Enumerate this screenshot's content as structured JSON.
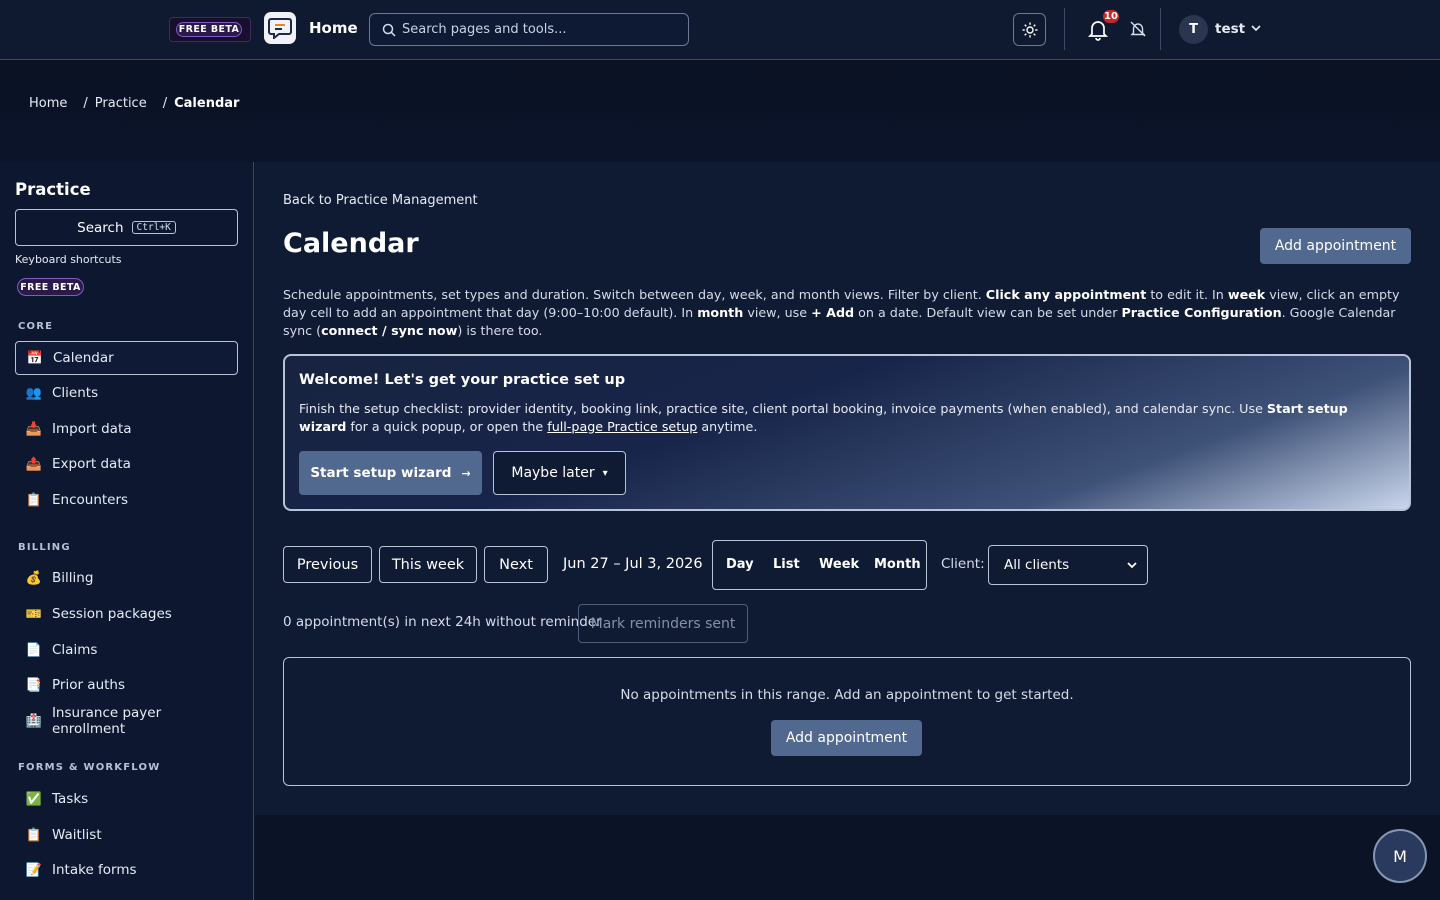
{
  "topbar": {
    "beta_badge": "FREE BETA",
    "home_title": "Home",
    "search_placeholder": "Search pages and tools...",
    "notification_count": "10",
    "user_initial": "T",
    "username": "test"
  },
  "breadcrumb": {
    "items": [
      "Home",
      "Practice",
      "Calendar"
    ],
    "separator": "/"
  },
  "sidebar": {
    "title": "Practice",
    "search_label": "Search",
    "search_shortcut": "Ctrl+K",
    "keyboard_shortcuts": "Keyboard shortcuts",
    "beta_badge": "FREE BETA",
    "sections": [
      {
        "label": "CORE",
        "items": [
          {
            "icon": "📅",
            "label": "Calendar"
          },
          {
            "icon": "👥",
            "label": "Clients"
          },
          {
            "icon": "📥",
            "label": "Import data"
          },
          {
            "icon": "📤",
            "label": "Export data"
          },
          {
            "icon": "📋",
            "label": "Encounters"
          }
        ]
      },
      {
        "label": "BILLING",
        "items": [
          {
            "icon": "💰",
            "label": "Billing"
          },
          {
            "icon": "🎫",
            "label": "Session packages"
          },
          {
            "icon": "📄",
            "label": "Claims"
          },
          {
            "icon": "📑",
            "label": "Prior auths"
          },
          {
            "icon": "🏥",
            "label": "Insurance payer enrollment"
          }
        ]
      },
      {
        "label": "FORMS & WORKFLOW",
        "items": [
          {
            "icon": "✅",
            "label": "Tasks"
          },
          {
            "icon": "📋",
            "label": "Waitlist"
          },
          {
            "icon": "📝",
            "label": "Intake forms"
          }
        ]
      }
    ]
  },
  "main": {
    "back_link": "Back to Practice Management",
    "title": "Calendar",
    "add_appointment": "Add appointment",
    "description": {
      "p1": "Schedule appointments, set types and duration. Switch between day, week, and month views. Filter by client. ",
      "b1": "Click any appointment",
      "p2": " to edit it. In ",
      "b2": "week",
      "p3": " view, click an empty day cell to add an appointment that day (9:00–10:00 default). In ",
      "b3": "month",
      "p4": " view, use ",
      "b4": "+ Add",
      "p5": " on a date. Default view can be set under ",
      "b5": "Practice Configuration",
      "p6": ". Google Calendar sync (",
      "b6": "connect / sync now",
      "p7": ") is there too."
    },
    "welcome": {
      "title": "Welcome! Let's get your practice set up",
      "t1": "Finish the setup checklist: provider identity, booking link, practice site, client portal booking, invoice payments (when enabled), and calendar sync. Use ",
      "b1": "Start setup wizard",
      "t2": " for a quick popup, or open the ",
      "link": "full-page Practice setup",
      "t3": " anytime.",
      "wizard_button": "Start setup wizard",
      "wizard_arrow": "→",
      "later_button": "Maybe later",
      "later_caret": "▾"
    },
    "nav": {
      "previous": "Previous",
      "this_week": "This week",
      "next": "Next",
      "range": "Jun 27 – Jul 3, 2026"
    },
    "views": [
      "Day",
      "List",
      "Week",
      "Month"
    ],
    "client_filter": {
      "label": "Client:",
      "selected": "All clients"
    },
    "reminders": {
      "text": "0 appointment(s) in next 24h without reminder",
      "button": "Mark reminders sent"
    },
    "empty": {
      "text": "No appointments in this range. Add an appointment to get started.",
      "button": "Add appointment"
    }
  },
  "fab": {
    "label": "M"
  },
  "colors": {
    "background": "#0b1326",
    "panel": "#0f1a33",
    "accent": "#51688f",
    "border": "#b9c3d6",
    "badge": "#c62828"
  }
}
